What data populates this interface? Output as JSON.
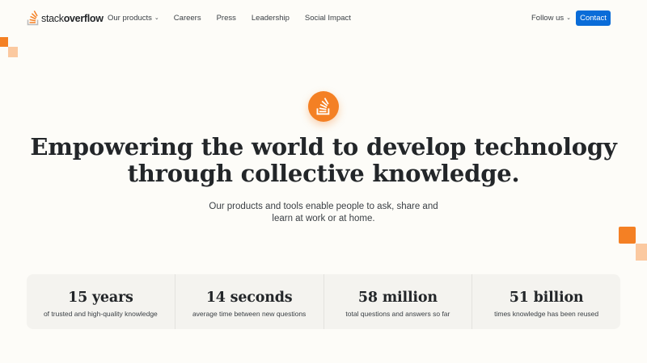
{
  "logo": {
    "text_regular": "stack",
    "text_bold": "overflow",
    "icon": "stackoverflow-logo-icon"
  },
  "nav": {
    "items": [
      {
        "label": "Our products",
        "has_dropdown": true
      },
      {
        "label": "Careers"
      },
      {
        "label": "Press"
      },
      {
        "label": "Leadership"
      },
      {
        "label": "Social Impact"
      }
    ],
    "follow_label": "Follow us",
    "contact_label": "Contact"
  },
  "hero": {
    "icon": "stackoverflow-icon",
    "headline_line1": "Empowering the world to develop technology",
    "headline_line2": "through collective knowledge",
    "headline_period": ".",
    "subtext_line1": "Our products and tools enable people to ask, share and",
    "subtext_line2": "learn at work or at home."
  },
  "stats": [
    {
      "value": "15 years",
      "label": "of trusted and high-quality knowledge"
    },
    {
      "value": "14 seconds",
      "label": "average time between new questions"
    },
    {
      "value": "58 million",
      "label": "total questions and answers so far"
    },
    {
      "value": "51 billion",
      "label": "times knowledge has been reused"
    }
  ],
  "colors": {
    "brand_orange": "#f48024",
    "accent_blue": "#0a6cd8",
    "background": "#fdfcf8"
  }
}
